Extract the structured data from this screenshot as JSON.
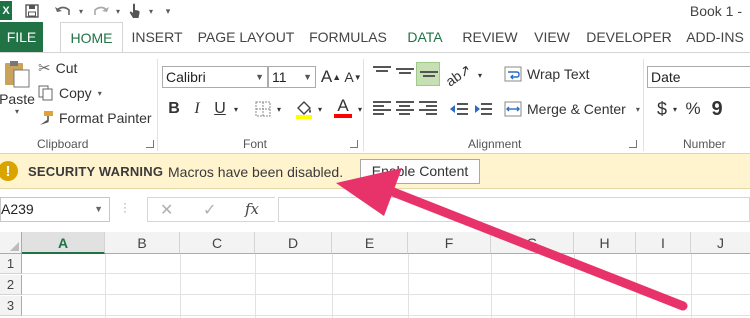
{
  "titlebar": {
    "app_logo": "X",
    "title": "Book 1 -",
    "qat_icons": [
      "save-icon",
      "undo-icon",
      "redo-icon",
      "touch-mode-icon",
      "customize-qat-icon"
    ]
  },
  "tabs": [
    {
      "label": "FILE"
    },
    {
      "label": "HOME"
    },
    {
      "label": "INSERT"
    },
    {
      "label": "PAGE LAYOUT"
    },
    {
      "label": "FORMULAS"
    },
    {
      "label": "DATA"
    },
    {
      "label": "REVIEW"
    },
    {
      "label": "VIEW"
    },
    {
      "label": "DEVELOPER"
    },
    {
      "label": "ADD-INS"
    }
  ],
  "ribbon": {
    "clipboard": {
      "paste_label": "Paste",
      "cut_label": "Cut",
      "copy_label": "Copy",
      "format_painter_label": "Format Painter",
      "group_label": "Clipboard"
    },
    "font": {
      "font_name": "Calibri",
      "font_size": "11",
      "bold": "B",
      "italic": "I",
      "underline": "U",
      "grow": "A",
      "shrink": "A",
      "font_color_glyph": "A",
      "group_label": "Font",
      "highlight_color": "#ffff00",
      "font_color": "#ff0000"
    },
    "alignment": {
      "wrap_text_label": "Wrap Text",
      "merge_center_label": "Merge & Center",
      "group_label": "Alignment"
    },
    "number": {
      "format_value": "Date",
      "currency": "$",
      "percent": "%",
      "comma": "9",
      "group_label": "Number"
    }
  },
  "security_bar": {
    "title": "SECURITY WARNING",
    "message": "Macros have been disabled.",
    "button_label": "Enable Content",
    "icon": "!"
  },
  "formula_bar": {
    "name_box": "A239",
    "cancel_icon": "✕",
    "enter_icon": "✓",
    "fx_label": "fx",
    "formula_value": ""
  },
  "grid": {
    "columns": [
      "A",
      "B",
      "C",
      "D",
      "E",
      "F",
      "G",
      "H",
      "I",
      "J"
    ],
    "rows": [
      "1",
      "2",
      "3"
    ],
    "selected_column": "A"
  },
  "annotation": {
    "arrow_color": "#e8336a"
  }
}
